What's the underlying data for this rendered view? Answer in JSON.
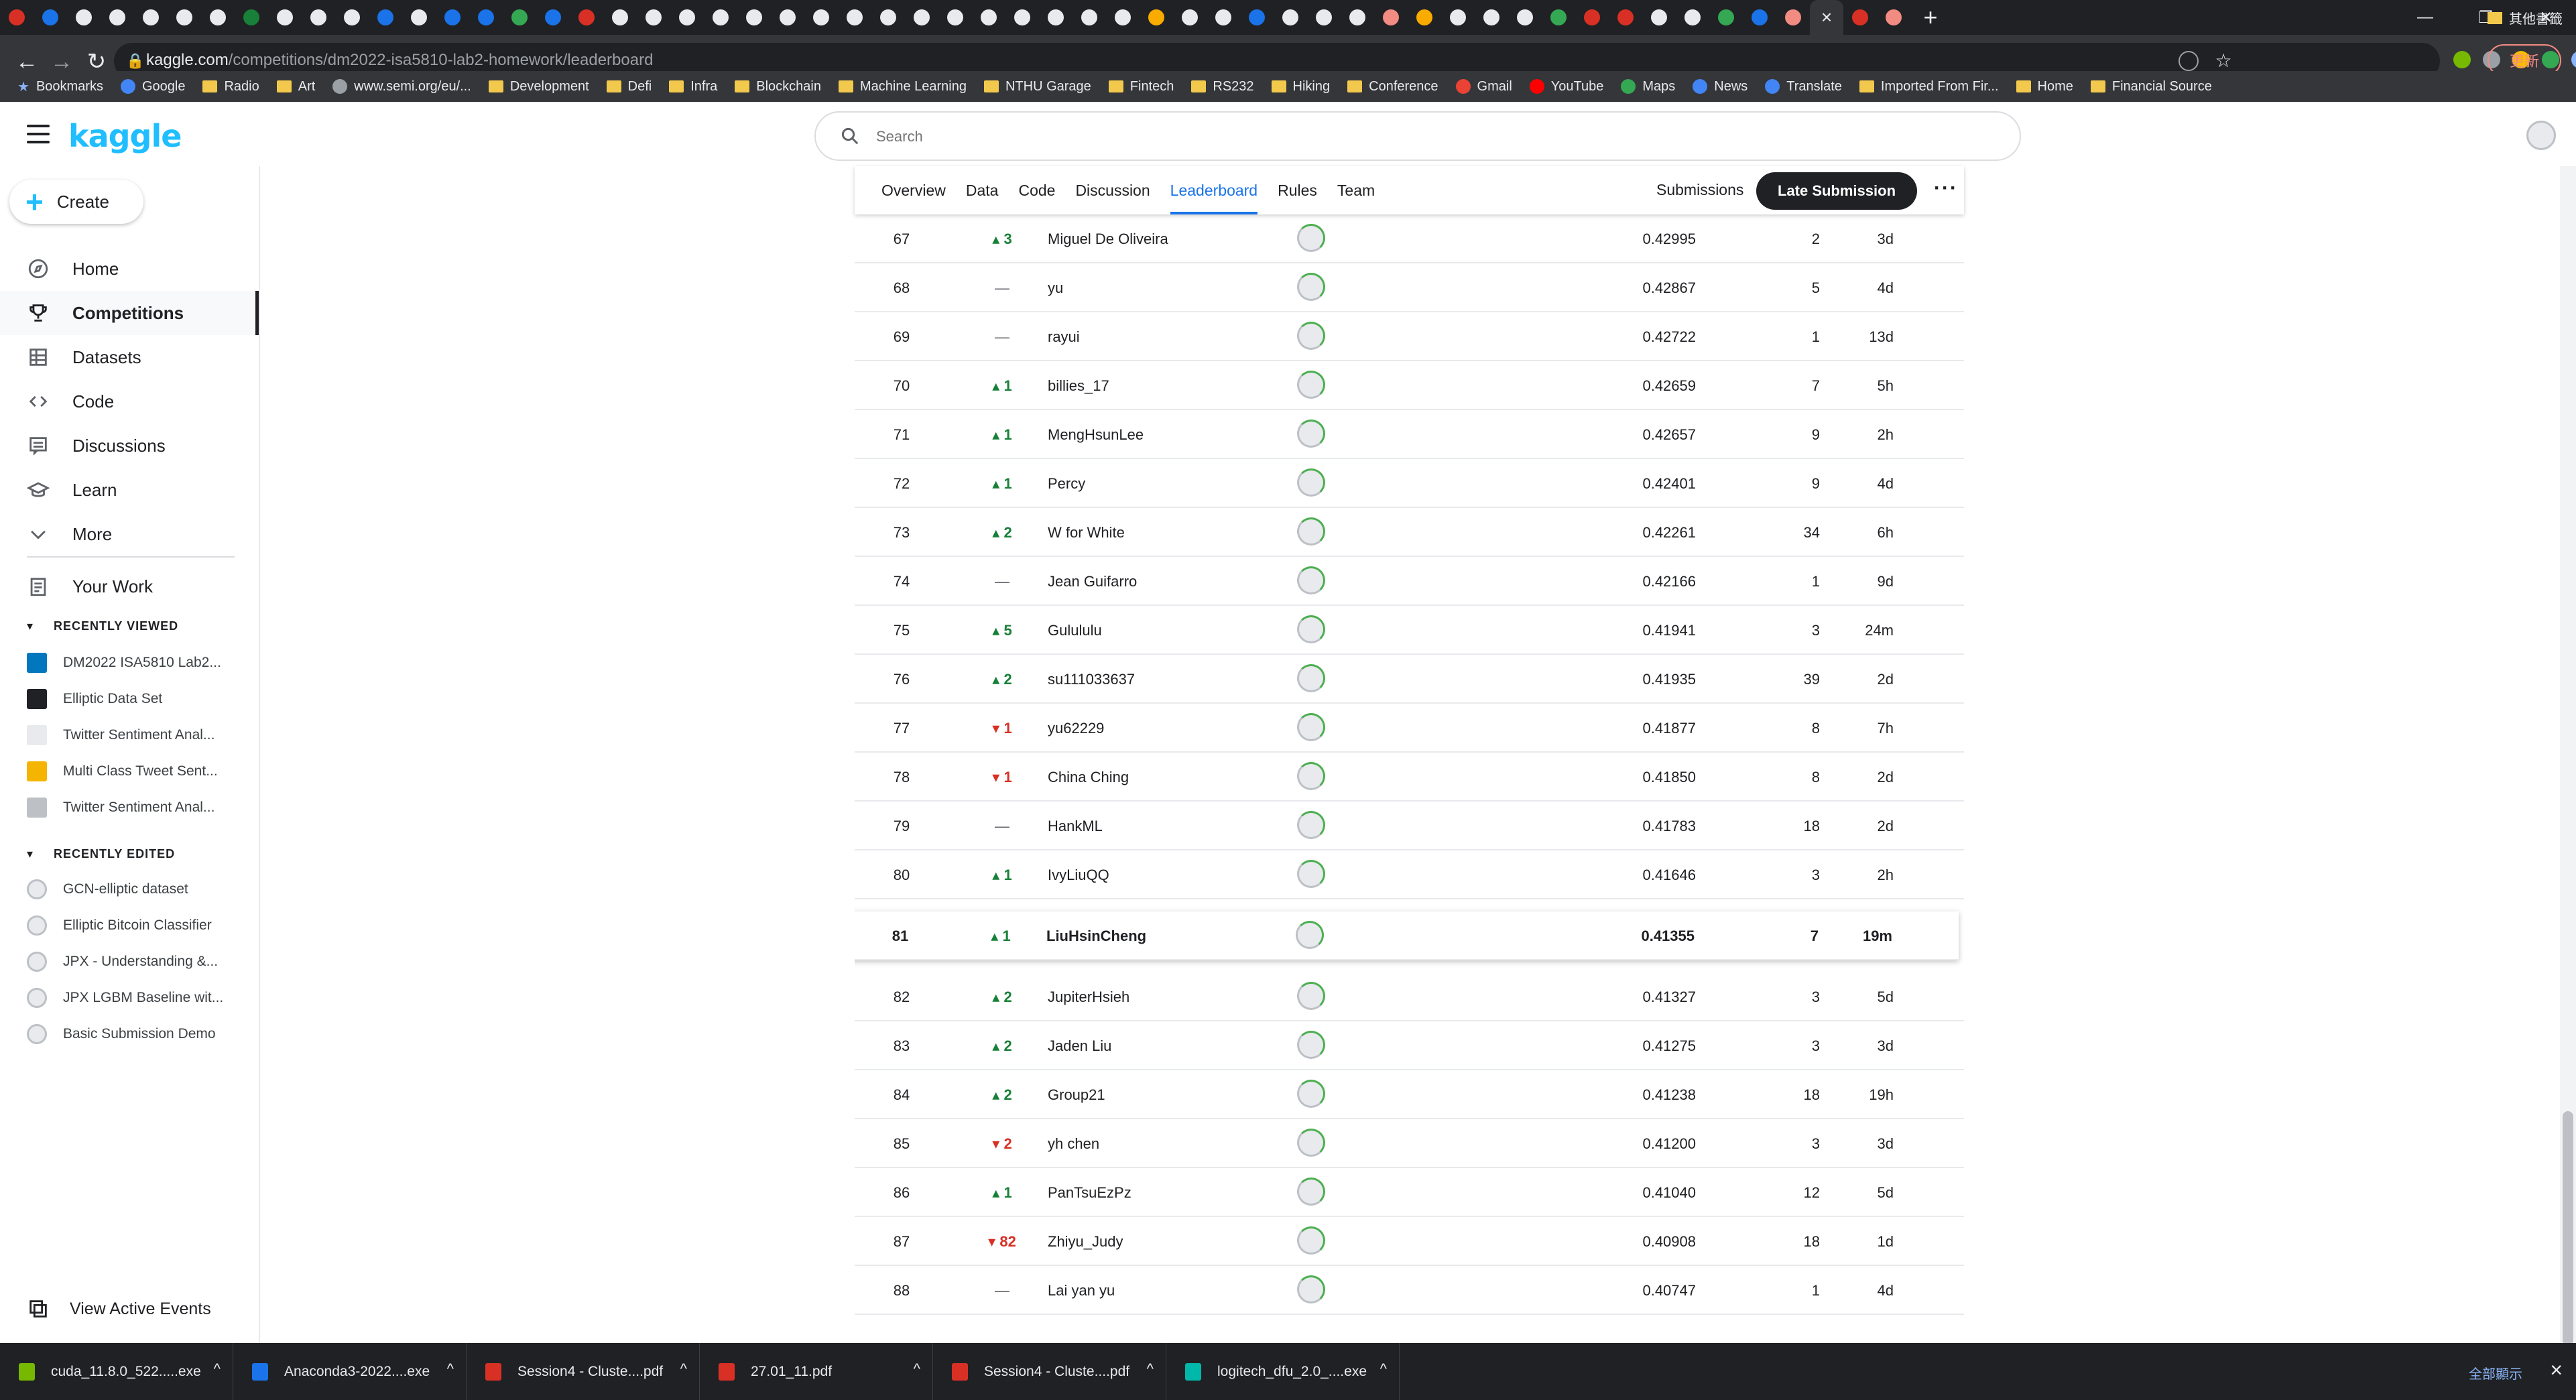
{
  "browser": {
    "tab_colors": [
      "#d93025",
      "#1a73e8",
      "#e8eaed",
      "#e8eaed",
      "#e8eaed",
      "#e8eaed",
      "#e8eaed",
      "#188038",
      "#e8eaed",
      "#e8eaed",
      "#e8eaed",
      "#1a73e8",
      "#e8eaed",
      "#1a73e8",
      "#1a73e8",
      "#34a853",
      "#1a73e8",
      "#d93025",
      "#e8eaed",
      "#e8eaed",
      "#e8eaed",
      "#e8eaed",
      "#e8eaed",
      "#e8eaed",
      "#e8eaed",
      "#e8eaed",
      "#e8eaed",
      "#e8eaed",
      "#e8eaed",
      "#e8eaed",
      "#e8eaed",
      "#e8eaed",
      "#e8eaed",
      "#e8eaed",
      "#f9ab00",
      "#e8eaed",
      "#e8eaed",
      "#1a73e8",
      "#e8eaed",
      "#e8eaed",
      "#e8eaed",
      "#f28b82",
      "#f9ab00",
      "#e8eaed",
      "#e8eaed",
      "#e8eaed",
      "#34a853",
      "#d93025",
      "#d93025",
      "#e8eaed",
      "#e8eaed",
      "#34a853",
      "#1a73e8",
      "#f28b82",
      "#1a73e8",
      "#d93025",
      "#f28b82"
    ],
    "url_host": "kaggle.com",
    "url_path": "/competitions/dm2022-isa5810-lab2-homework/leaderboard",
    "update_label": "更新",
    "bookmarks": [
      {
        "label": "Bookmarks",
        "icon": "star-icon"
      },
      {
        "label": "Google",
        "icon": "google-icon"
      },
      {
        "label": "Radio",
        "icon": "folder-icon"
      },
      {
        "label": "Art",
        "icon": "folder-icon"
      },
      {
        "label": "www.semi.org/eu/...",
        "icon": "globe-icon"
      },
      {
        "label": "Development",
        "icon": "folder-icon"
      },
      {
        "label": "Defi",
        "icon": "folder-icon"
      },
      {
        "label": "Infra",
        "icon": "folder-icon"
      },
      {
        "label": "Blockchain",
        "icon": "folder-icon"
      },
      {
        "label": "Machine Learning",
        "icon": "folder-icon"
      },
      {
        "label": "NTHU Garage",
        "icon": "folder-icon"
      },
      {
        "label": "Fintech",
        "icon": "folder-icon"
      },
      {
        "label": "RS232",
        "icon": "folder-icon"
      },
      {
        "label": "Hiking",
        "icon": "folder-icon"
      },
      {
        "label": "Conference",
        "icon": "folder-icon"
      },
      {
        "label": "Gmail",
        "icon": "gmail-icon"
      },
      {
        "label": "YouTube",
        "icon": "youtube-icon"
      },
      {
        "label": "Maps",
        "icon": "maps-icon"
      },
      {
        "label": "News",
        "icon": "news-icon"
      },
      {
        "label": "Translate",
        "icon": "translate-icon"
      },
      {
        "label": "Imported From Fir...",
        "icon": "folder-icon"
      },
      {
        "label": "Home",
        "icon": "folder-icon"
      },
      {
        "label": "Financial Source",
        "icon": "folder-icon"
      }
    ],
    "other_bookmarks": "其他書籤"
  },
  "kaggle": {
    "logo": "kaggle",
    "search_placeholder": "Search",
    "create_label": "Create",
    "nav": [
      {
        "label": "Home",
        "icon": "compass-icon"
      },
      {
        "label": "Competitions",
        "icon": "trophy-icon",
        "active": true
      },
      {
        "label": "Datasets",
        "icon": "table-icon"
      },
      {
        "label": "Code",
        "icon": "code-icon"
      },
      {
        "label": "Discussions",
        "icon": "discussion-icon"
      },
      {
        "label": "Learn",
        "icon": "graduation-cap-icon"
      },
      {
        "label": "More",
        "icon": "chevron-down-icon"
      }
    ],
    "your_work": "Your Work",
    "recently_viewed_title": "RECENTLY VIEWED",
    "recently_viewed": [
      {
        "label": "DM2022 ISA5810 Lab2...",
        "color": "#0277bd"
      },
      {
        "label": "Elliptic Data Set",
        "color": "#202124"
      },
      {
        "label": "Twitter Sentiment Anal...",
        "color": "#e8eaed"
      },
      {
        "label": "Multi Class Tweet Sent...",
        "color": "#f4b400"
      },
      {
        "label": "Twitter Sentiment Anal...",
        "color": "#bdc1c6"
      }
    ],
    "recently_edited_title": "RECENTLY EDITED",
    "recently_edited": [
      "GCN-elliptic dataset",
      "Elliptic Bitcoin Classifier",
      "JPX - Understanding &...",
      "JPX LGBM Baseline wit...",
      "Basic Submission Demo"
    ],
    "view_active_events": "View Active Events"
  },
  "competition": {
    "tabs": [
      "Overview",
      "Data",
      "Code",
      "Discussion",
      "Leaderboard",
      "Rules",
      "Team"
    ],
    "active_tab": "Leaderboard",
    "submissions_label": "Submissions",
    "late_submission_label": "Late Submission",
    "more_label": "···"
  },
  "leaderboard": [
    {
      "rank": "67",
      "dir": "up",
      "delta": "3",
      "name": "Miguel De Oliveira",
      "score": "0.42995",
      "entries": "2",
      "last": "3d"
    },
    {
      "rank": "68",
      "dir": "same",
      "delta": "—",
      "name": "yu",
      "score": "0.42867",
      "entries": "5",
      "last": "4d"
    },
    {
      "rank": "69",
      "dir": "same",
      "delta": "—",
      "name": "rayui",
      "score": "0.42722",
      "entries": "1",
      "last": "13d"
    },
    {
      "rank": "70",
      "dir": "up",
      "delta": "1",
      "name": "billies_17",
      "score": "0.42659",
      "entries": "7",
      "last": "5h"
    },
    {
      "rank": "71",
      "dir": "up",
      "delta": "1",
      "name": "MengHsunLee",
      "score": "0.42657",
      "entries": "9",
      "last": "2h"
    },
    {
      "rank": "72",
      "dir": "up",
      "delta": "1",
      "name": "Percy",
      "score": "0.42401",
      "entries": "9",
      "last": "4d"
    },
    {
      "rank": "73",
      "dir": "up",
      "delta": "2",
      "name": "W for White",
      "score": "0.42261",
      "entries": "34",
      "last": "6h"
    },
    {
      "rank": "74",
      "dir": "same",
      "delta": "—",
      "name": "Jean Guifarro",
      "score": "0.42166",
      "entries": "1",
      "last": "9d"
    },
    {
      "rank": "75",
      "dir": "up",
      "delta": "5",
      "name": "Gulululu",
      "score": "0.41941",
      "entries": "3",
      "last": "24m"
    },
    {
      "rank": "76",
      "dir": "up",
      "delta": "2",
      "name": "su111033637",
      "score": "0.41935",
      "entries": "39",
      "last": "2d"
    },
    {
      "rank": "77",
      "dir": "down",
      "delta": "1",
      "name": "yu62229",
      "score": "0.41877",
      "entries": "8",
      "last": "7h"
    },
    {
      "rank": "78",
      "dir": "down",
      "delta": "1",
      "name": "China Ching",
      "score": "0.41850",
      "entries": "8",
      "last": "2d"
    },
    {
      "rank": "79",
      "dir": "same",
      "delta": "—",
      "name": "HankML",
      "score": "0.41783",
      "entries": "18",
      "last": "2d"
    },
    {
      "rank": "80",
      "dir": "up",
      "delta": "1",
      "name": "IvyLiuQQ",
      "score": "0.41646",
      "entries": "3",
      "last": "2h"
    },
    {
      "rank": "81",
      "dir": "up",
      "delta": "1",
      "name": "LiuHsinCheng",
      "score": "0.41355",
      "entries": "7",
      "last": "19m",
      "highlight": true
    },
    {
      "rank": "82",
      "dir": "up",
      "delta": "2",
      "name": "JupiterHsieh",
      "score": "0.41327",
      "entries": "3",
      "last": "5d"
    },
    {
      "rank": "83",
      "dir": "up",
      "delta": "2",
      "name": "Jaden Liu",
      "score": "0.41275",
      "entries": "3",
      "last": "3d"
    },
    {
      "rank": "84",
      "dir": "up",
      "delta": "2",
      "name": "Group21",
      "score": "0.41238",
      "entries": "18",
      "last": "19h"
    },
    {
      "rank": "85",
      "dir": "down",
      "delta": "2",
      "name": "yh chen",
      "score": "0.41200",
      "entries": "3",
      "last": "3d"
    },
    {
      "rank": "86",
      "dir": "up",
      "delta": "1",
      "name": "PanTsuEzPz",
      "score": "0.41040",
      "entries": "12",
      "last": "5d"
    },
    {
      "rank": "87",
      "dir": "down",
      "delta": "82",
      "name": "Zhiyu_Judy",
      "score": "0.40908",
      "entries": "18",
      "last": "1d"
    },
    {
      "rank": "88",
      "dir": "same",
      "delta": "—",
      "name": "Lai yan yu",
      "score": "0.40747",
      "entries": "1",
      "last": "4d"
    }
  ],
  "downloads": [
    {
      "name": "cuda_11.8.0_522.....exe",
      "color": "#76b900"
    },
    {
      "name": "Anaconda3-2022....exe",
      "color": "#1a73e8"
    },
    {
      "name": "Session4 - Cluste....pdf",
      "color": "#d93025"
    },
    {
      "name": "27.01_11.pdf",
      "color": "#d93025"
    },
    {
      "name": "Session4 - Cluste....pdf",
      "color": "#d93025"
    },
    {
      "name": "logitech_dfu_2.0_....exe",
      "color": "#00b8a9"
    }
  ],
  "downloads_show_all": "全部顯示"
}
